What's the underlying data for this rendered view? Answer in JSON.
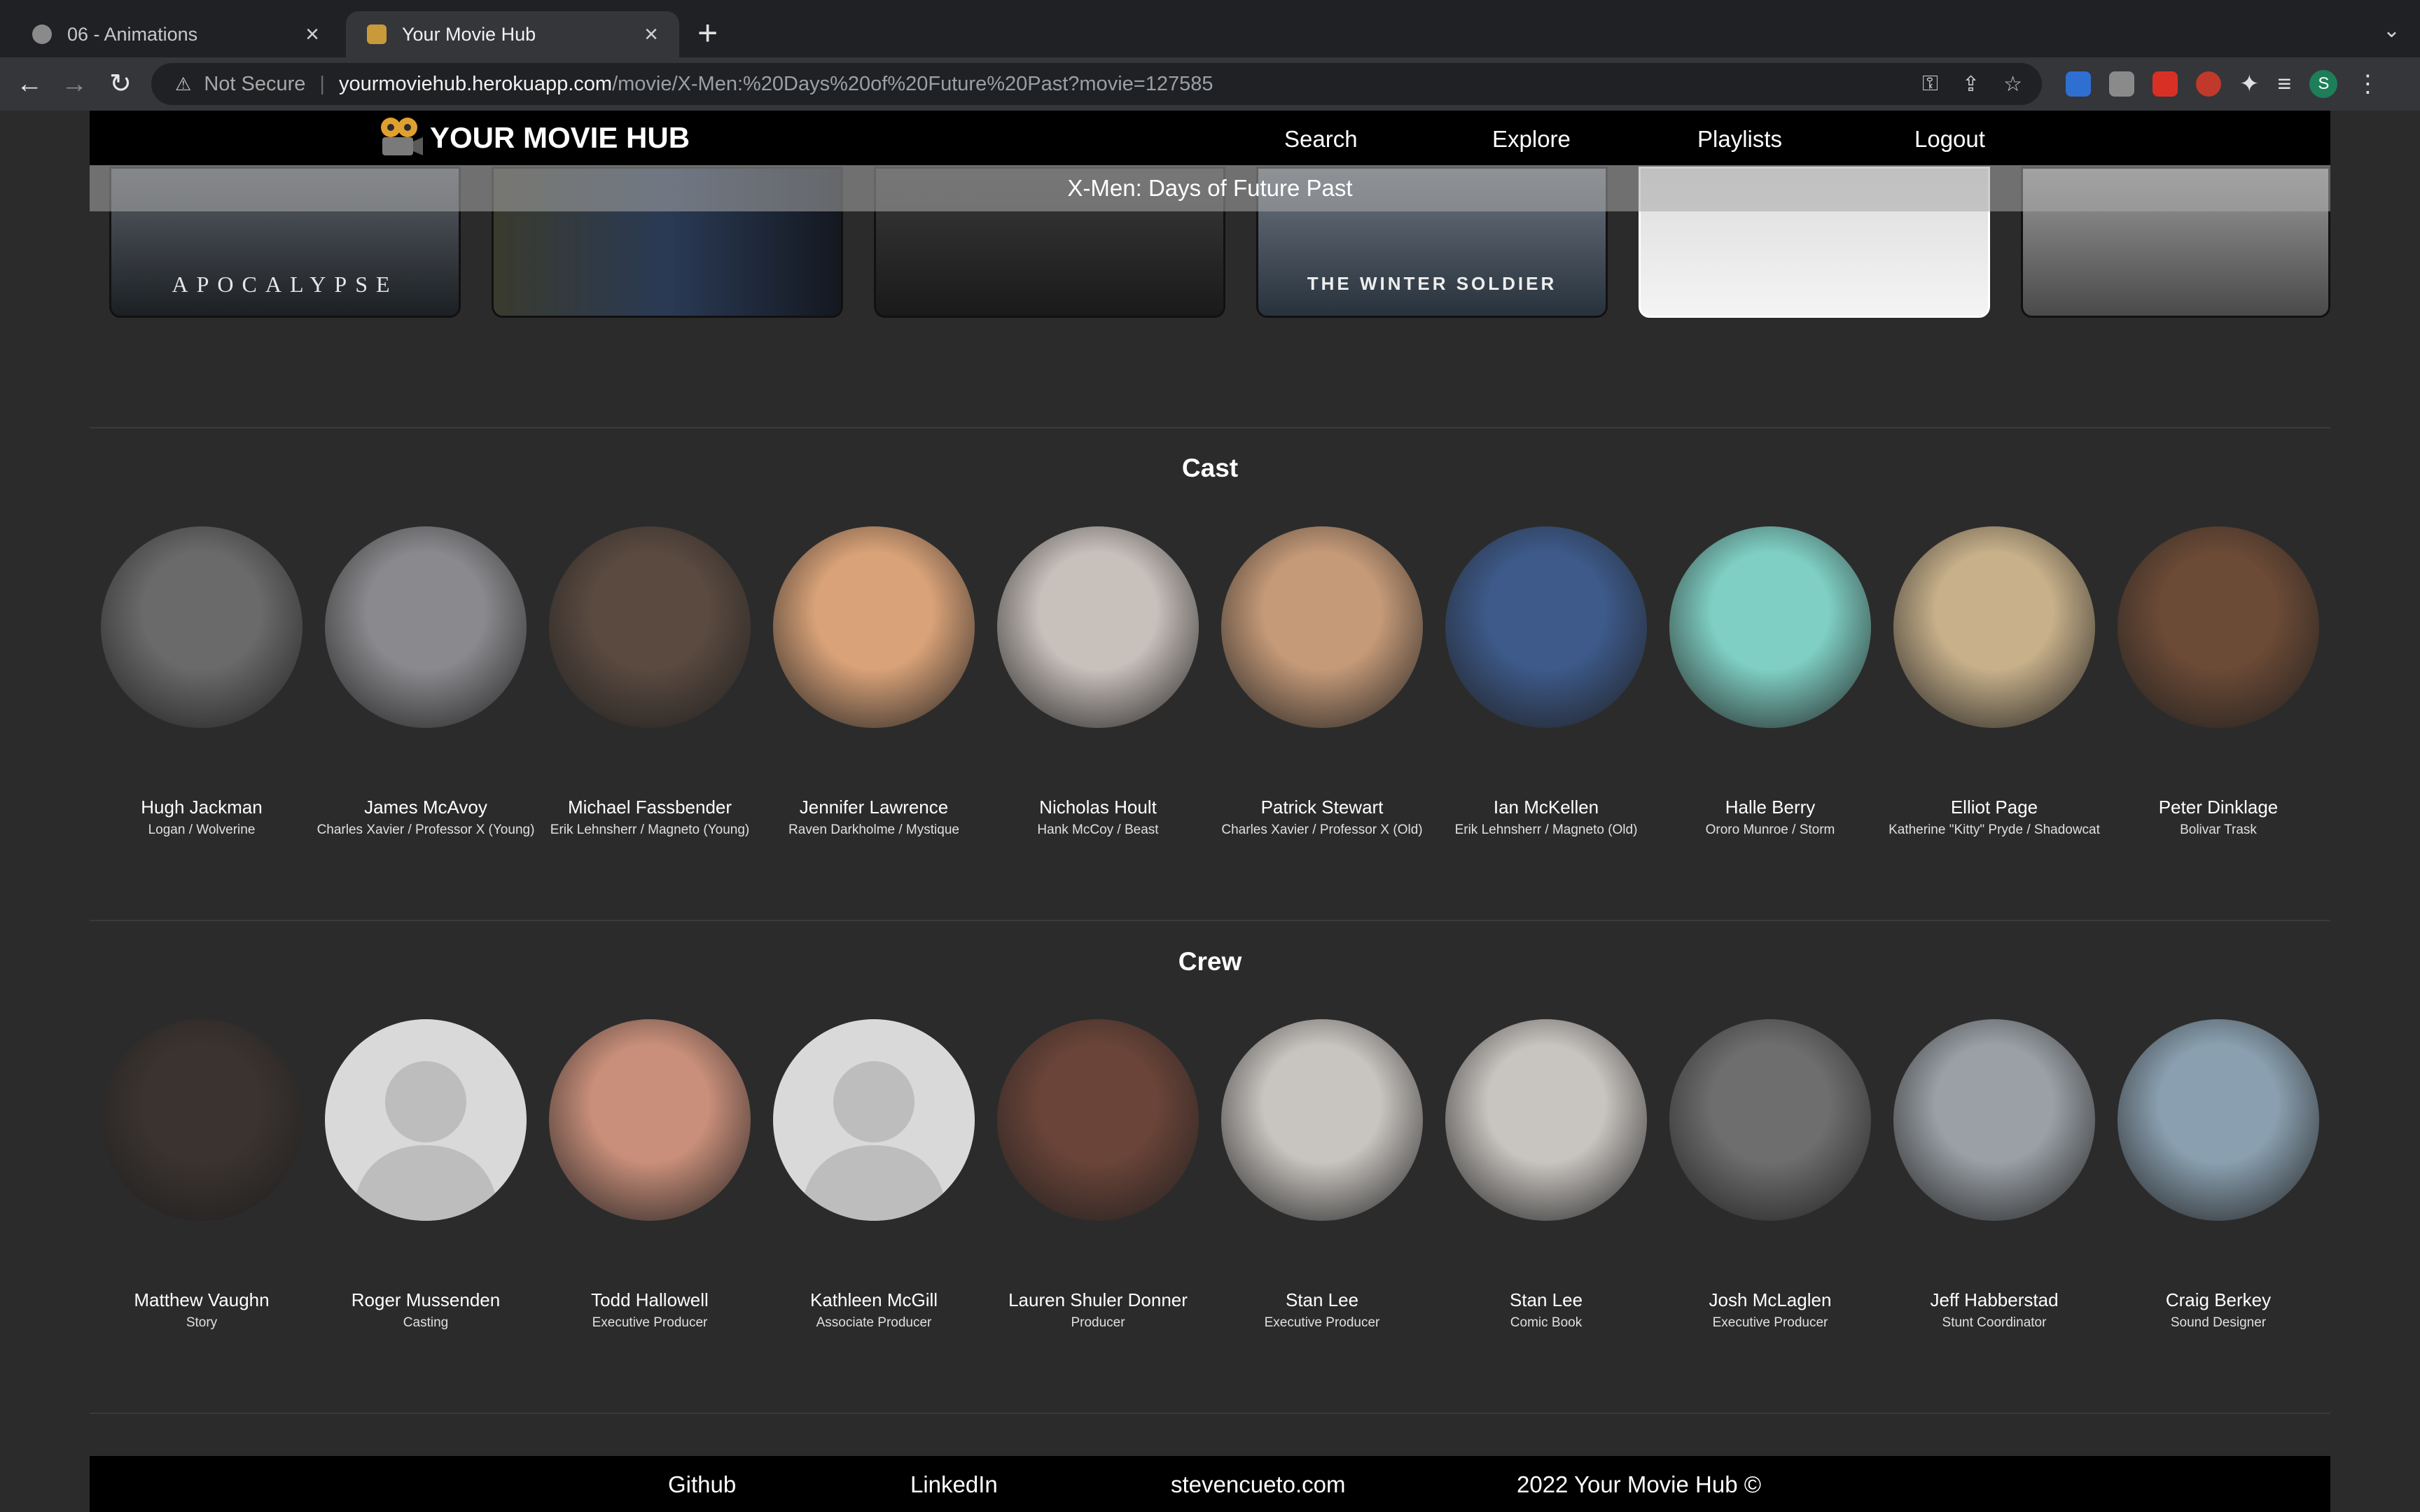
{
  "browser": {
    "tabs": [
      {
        "title": "06 - Animations",
        "active": false
      },
      {
        "title": "Your Movie Hub",
        "active": true
      }
    ],
    "address": {
      "security_label": "Not Secure",
      "host": "yourmoviehub.herokuapp.com",
      "path": "/movie/X-Men:%20Days%20of%20Future%20Past?movie=127585"
    },
    "profile_initial": "S"
  },
  "site": {
    "logo_text": "YOUR MOVIE HUB",
    "nav": [
      "Search",
      "Explore",
      "Playlists",
      "Logout"
    ],
    "movie_title": "X-Men: Days of Future Past",
    "carousel": [
      {
        "caption": "APOCALYPSE"
      },
      {
        "caption": ""
      },
      {
        "caption": ""
      },
      {
        "caption": "THE WINTER SOLDIER"
      },
      {
        "caption": ""
      },
      {
        "caption": ""
      }
    ]
  },
  "cast": {
    "heading": "Cast",
    "people": [
      {
        "name": "Hugh Jackman",
        "role": "Logan / Wolverine",
        "tone": "#6a6a6a"
      },
      {
        "name": "James McAvoy",
        "role": "Charles Xavier / Professor X (Young)",
        "tone": "#8a8a8e"
      },
      {
        "name": "Michael Fassbender",
        "role": "Erik Lehnsherr / Magneto (Young)",
        "tone": "#5a4a40"
      },
      {
        "name": "Jennifer Lawrence",
        "role": "Raven Darkholme / Mystique",
        "tone": "#d9a278"
      },
      {
        "name": "Nicholas Hoult",
        "role": "Hank McCoy / Beast",
        "tone": "#c8c0bb"
      },
      {
        "name": "Patrick Stewart",
        "role": "Charles Xavier / Professor X (Old)",
        "tone": "#c59a78"
      },
      {
        "name": "Ian McKellen",
        "role": "Erik Lehnsherr / Magneto (Old)",
        "tone": "#3d5a8a"
      },
      {
        "name": "Halle Berry",
        "role": "Ororo Munroe / Storm",
        "tone": "#7fcfc4"
      },
      {
        "name": "Elliot Page",
        "role": "Katherine \"Kitty\" Pryde / Shadowcat",
        "tone": "#c7b08a"
      },
      {
        "name": "Peter Dinklage",
        "role": "Bolivar Trask",
        "tone": "#6b4a36"
      }
    ]
  },
  "crew": {
    "heading": "Crew",
    "people": [
      {
        "name": "Matthew Vaughn",
        "role": "Story",
        "tone": "#3a3330"
      },
      {
        "name": "Roger Mussenden",
        "role": "Casting",
        "tone": "placeholder"
      },
      {
        "name": "Todd Hallowell",
        "role": "Executive Producer",
        "tone": "#c98f7a"
      },
      {
        "name": "Kathleen McGill",
        "role": "Associate Producer",
        "tone": "placeholder"
      },
      {
        "name": "Lauren Shuler Donner",
        "role": "Producer",
        "tone": "#6a4438"
      },
      {
        "name": "Stan Lee",
        "role": "Executive Producer",
        "tone": "#c8c4c0"
      },
      {
        "name": "Stan Lee",
        "role": "Comic Book",
        "tone": "#c8c4c0"
      },
      {
        "name": "Josh McLaglen",
        "role": "Executive Producer",
        "tone": "#6e6e6e"
      },
      {
        "name": "Jeff Habberstad",
        "role": "Stunt Coordinator",
        "tone": "#9aa0a6"
      },
      {
        "name": "Craig Berkey",
        "role": "Sound Designer",
        "tone": "#8aa0b0"
      }
    ]
  },
  "footer": {
    "links": [
      "Github",
      "LinkedIn",
      "stevencueto.com"
    ],
    "copyright": "2022 Your Movie Hub ©"
  }
}
